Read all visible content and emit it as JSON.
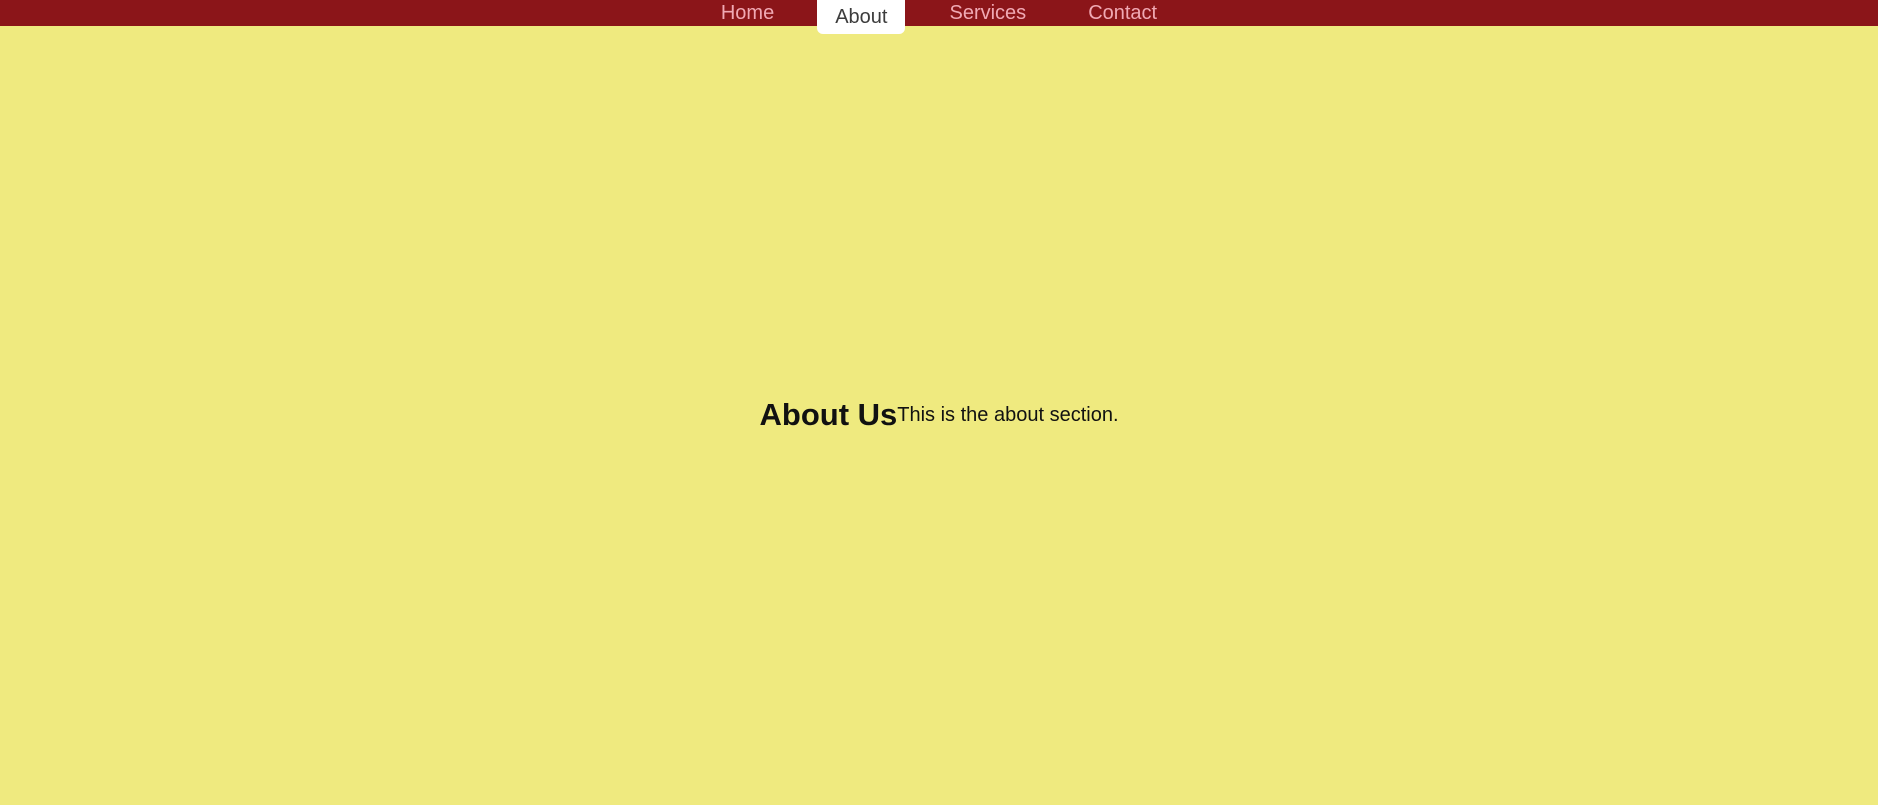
{
  "nav": {
    "items": [
      {
        "label": "Home"
      },
      {
        "label": "About"
      },
      {
        "label": "Services"
      },
      {
        "label": "Contact"
      }
    ],
    "active": "About"
  },
  "section": {
    "title": "About Us",
    "text": "This is the about section."
  },
  "colors": {
    "nav_background": "#8b1519",
    "nav_text": "#f0a9b4",
    "active_tab_background": "#ffffff",
    "active_tab_text": "#3c3c3c",
    "page_background": "#efea7f",
    "body_text": "#111111"
  }
}
